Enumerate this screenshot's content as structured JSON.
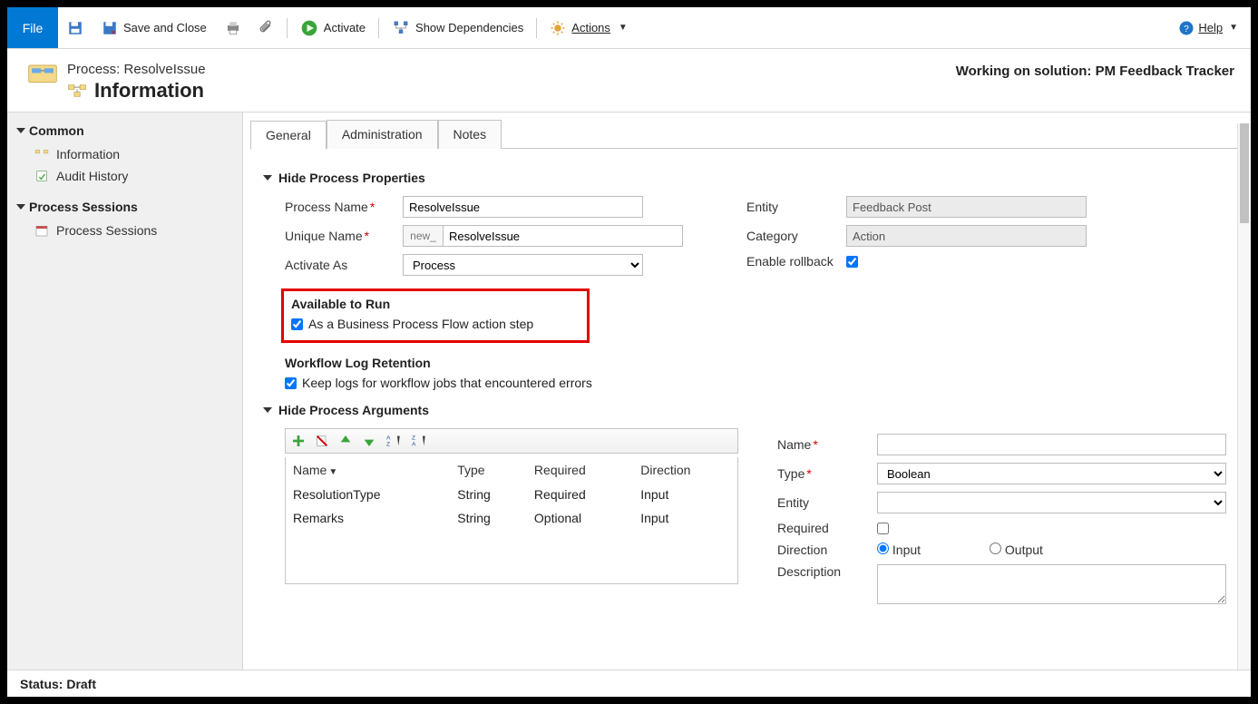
{
  "toolbar": {
    "file": "File",
    "save_and_close": "Save and Close",
    "activate": "Activate",
    "show_dependencies": "Show Dependencies",
    "actions": "Actions",
    "help": "Help"
  },
  "header": {
    "breadcrumb": "Process: ResolveIssue",
    "title": "Information",
    "solution_prefix": "Working on solution: ",
    "solution_name": "PM Feedback Tracker"
  },
  "sidebar": {
    "group1_title": "Common",
    "group1_items": [
      "Information",
      "Audit History"
    ],
    "group2_title": "Process Sessions",
    "group2_items": [
      "Process Sessions"
    ]
  },
  "tabs": [
    "General",
    "Administration",
    "Notes"
  ],
  "section1": {
    "toggle": "Hide Process Properties",
    "process_name_label": "Process Name",
    "process_name": "ResolveIssue",
    "unique_name_label": "Unique Name",
    "unique_prefix": "new_",
    "unique_name": "ResolveIssue",
    "activate_as_label": "Activate As",
    "activate_as": "Process",
    "entity_label": "Entity",
    "entity": "Feedback Post",
    "category_label": "Category",
    "category": "Action",
    "enable_rollback_label": "Enable rollback",
    "available_title": "Available to Run",
    "available_cb": "As a Business Process Flow action step",
    "retention_title": "Workflow Log Retention",
    "retention_cb": "Keep logs for workflow jobs that encountered errors"
  },
  "section2": {
    "toggle": "Hide Process Arguments",
    "columns": {
      "name": "Name",
      "type": "Type",
      "required": "Required",
      "direction": "Direction"
    },
    "rows": [
      {
        "name": "ResolutionType",
        "type": "String",
        "required": "Required",
        "direction": "Input"
      },
      {
        "name": "Remarks",
        "type": "String",
        "required": "Optional",
        "direction": "Input"
      }
    ],
    "right": {
      "name_label": "Name",
      "type_label": "Type",
      "type_value": "Boolean",
      "entity_label": "Entity",
      "required_label": "Required",
      "direction_label": "Direction",
      "direction_input": "Input",
      "direction_output": "Output",
      "description_label": "Description"
    }
  },
  "statusbar": "Status: Draft"
}
